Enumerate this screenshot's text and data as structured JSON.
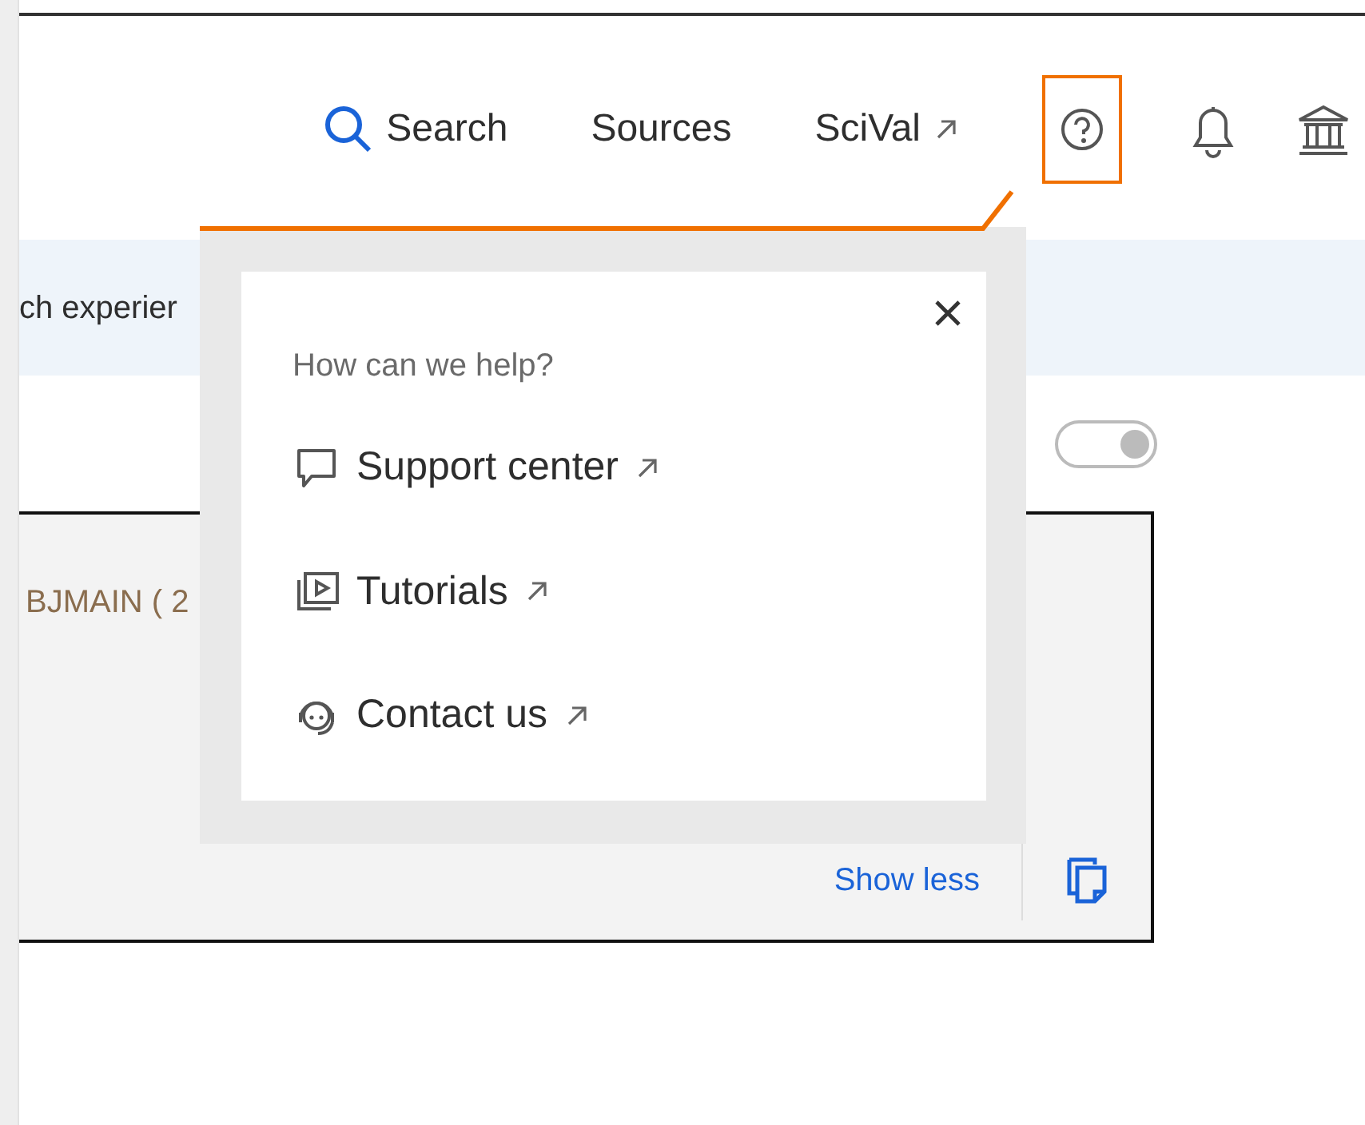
{
  "nav": [
    {
      "label": "Search",
      "kind": "search"
    },
    {
      "label": "Sources",
      "kind": "plain"
    },
    {
      "label": "SciVal",
      "kind": "external"
    }
  ],
  "help_button": {
    "active": true
  },
  "banner": {
    "text": "ch experier"
  },
  "toggle": {
    "on": true
  },
  "card": {
    "text": "BJMAIN ( 2",
    "link": "Show less"
  },
  "help_popup": {
    "heading": "How can we help?",
    "items": [
      {
        "label": "Support center",
        "kind": "chat"
      },
      {
        "label": "Tutorials",
        "kind": "video"
      },
      {
        "label": "Contact us",
        "kind": "agent"
      }
    ]
  }
}
